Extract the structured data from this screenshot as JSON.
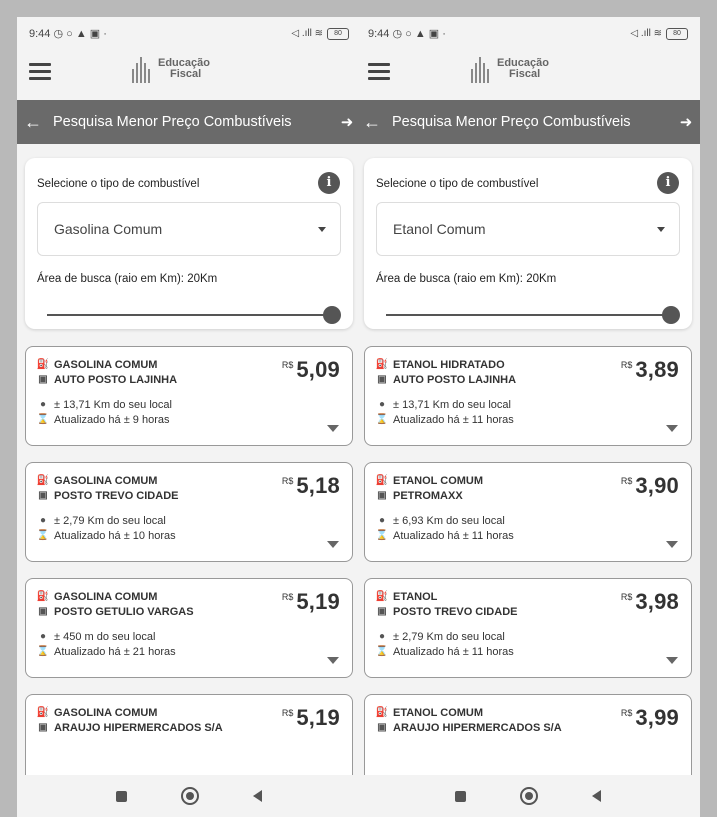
{
  "status": {
    "time": "9:44",
    "icons": "◷ ○ ▲ ▣ ·",
    "battery": "80"
  },
  "app": {
    "logo_line1": "Educação",
    "logo_line2": "Fiscal"
  },
  "header": {
    "title": "Pesquisa Menor Preço Combustíveis"
  },
  "filter": {
    "fuel_label": "Selecione o tipo de combustível",
    "range_label": "Área de busca (raio em Km): 20Km",
    "range_value_km": 20
  },
  "currency": "R$",
  "screens": [
    {
      "selected_fuel": "Gasolina Comum",
      "results": [
        {
          "product": "GASOLINA COMUM",
          "station": "AUTO POSTO LAJINHA",
          "distance": "± 13,71 Km do seu local",
          "updated": "Atualizado há ± 9 horas",
          "price": "5,09"
        },
        {
          "product": "GASOLINA COMUM",
          "station": "POSTO TREVO CIDADE",
          "distance": "± 2,79 Km do seu local",
          "updated": "Atualizado há ± 10 horas",
          "price": "5,18"
        },
        {
          "product": "GASOLINA COMUM",
          "station": "POSTO GETULIO VARGAS",
          "distance": "± 450 m do seu local",
          "updated": "Atualizado há ± 21 horas",
          "price": "5,19"
        },
        {
          "product": "GASOLINA COMUM",
          "station": "ARAUJO HIPERMERCADOS S/A",
          "distance": "",
          "updated": "",
          "price": "5,19"
        }
      ]
    },
    {
      "selected_fuel": "Etanol Comum",
      "results": [
        {
          "product": "ETANOL HIDRATADO",
          "station": "AUTO POSTO LAJINHA",
          "distance": "± 13,71 Km do seu local",
          "updated": "Atualizado há ± 11 horas",
          "price": "3,89"
        },
        {
          "product": "ETANOL COMUM",
          "station": "PETROMAXX",
          "distance": "± 6,93 Km do seu local",
          "updated": "Atualizado há ± 11 horas",
          "price": "3,90"
        },
        {
          "product": "ETANOL",
          "station": "POSTO TREVO CIDADE",
          "distance": "± 2,79 Km do seu local",
          "updated": "Atualizado há ± 11 horas",
          "price": "3,98"
        },
        {
          "product": "ETANOL COMUM",
          "station": "ARAUJO HIPERMERCADOS S/A",
          "distance": "",
          "updated": "",
          "price": "3,99"
        }
      ]
    }
  ]
}
